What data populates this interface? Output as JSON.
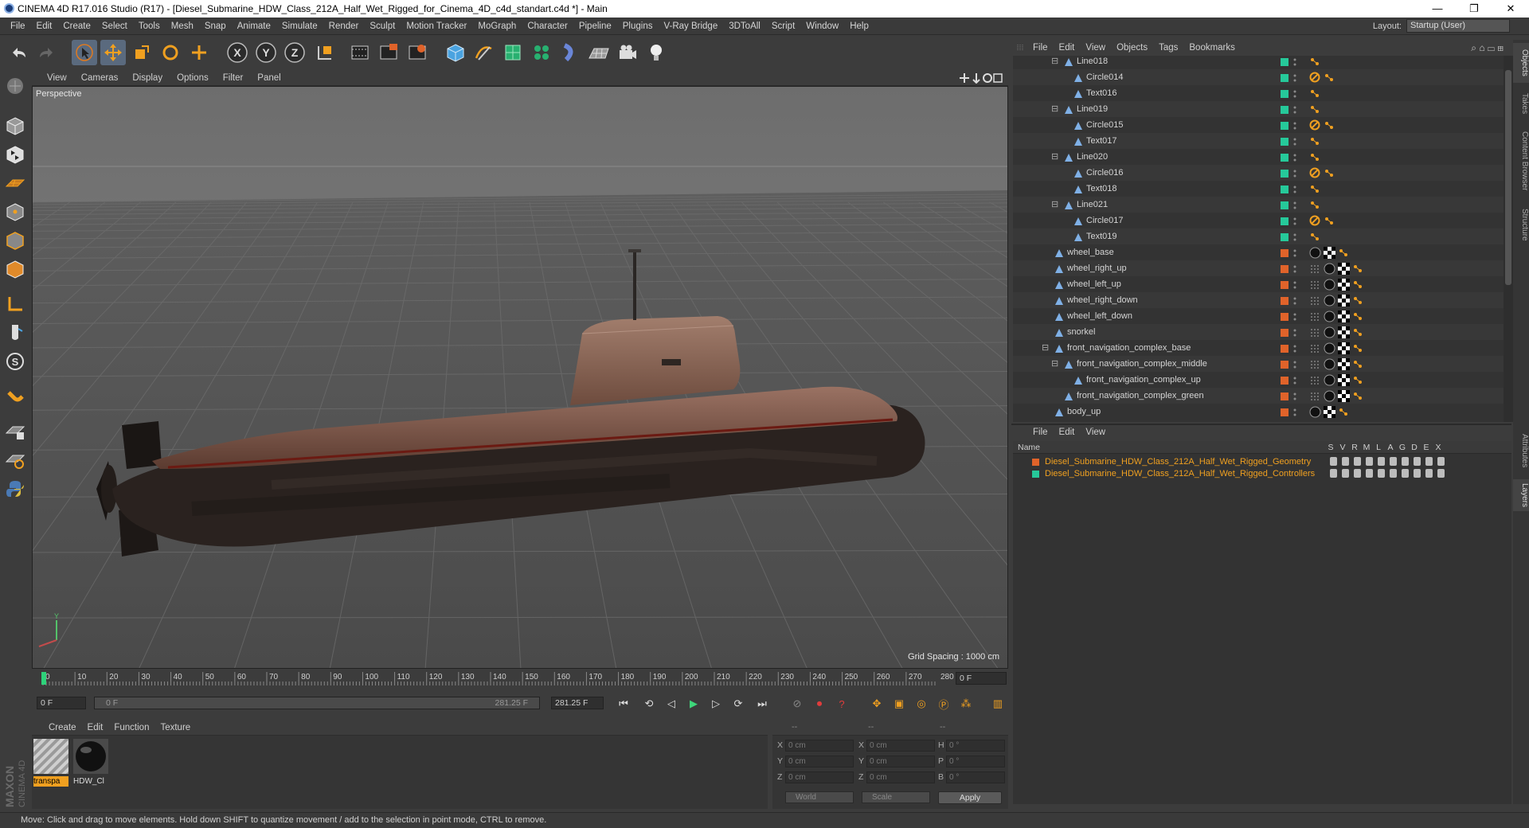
{
  "window": {
    "title": "CINEMA 4D R17.016 Studio (R17) - [Diesel_Submarine_HDW_Class_212A_Half_Wet_Rigged_for_Cinema_4D_c4d_standart.c4d *] - Main",
    "controls": [
      "—",
      "❐",
      "✕"
    ]
  },
  "menubar": {
    "items": [
      "File",
      "Edit",
      "Create",
      "Select",
      "Tools",
      "Mesh",
      "Snap",
      "Animate",
      "Simulate",
      "Render",
      "Sculpt",
      "Motion Tracker",
      "MoGraph",
      "Character",
      "Pipeline",
      "Plugins",
      "V-Ray Bridge",
      "3DToAll",
      "Script",
      "Window",
      "Help"
    ],
    "layout_label": "Layout:",
    "layout_value": "Startup (User)"
  },
  "toolbar": {
    "icons": [
      "undo-icon",
      "redo-icon",
      "live-selection-icon",
      "move-icon",
      "scale-icon",
      "rotate-icon",
      "recent-tool-icon",
      "x-axis-icon",
      "y-axis-icon",
      "z-axis-icon",
      "world-coords-icon",
      "render-view-icon",
      "render-picture-viewer-icon",
      "edit-render-settings-icon",
      "cube-primitive-icon",
      "pen-spline-icon",
      "subdivision-icon",
      "cloner-icon",
      "deformer-icon",
      "floor-icon",
      "camera-icon",
      "light-icon"
    ],
    "axis_letters": [
      "X",
      "Y",
      "Z"
    ]
  },
  "viewport": {
    "menu": [
      "View",
      "Cameras",
      "Display",
      "Options",
      "Filter",
      "Panel"
    ],
    "label": "Perspective",
    "grid_spacing": "Grid Spacing : 1000 cm",
    "axis_y": "Y"
  },
  "timeline": {
    "ticks": [
      "0",
      "10",
      "20",
      "30",
      "40",
      "50",
      "60",
      "70",
      "80",
      "90",
      "100",
      "110",
      "120",
      "130",
      "140",
      "150",
      "160",
      "170",
      "180",
      "190",
      "200",
      "210",
      "220",
      "230",
      "240",
      "250",
      "260",
      "270",
      "280"
    ],
    "end_frame": "0 F",
    "current": "0 F",
    "range_start": "0 F",
    "range_end": "281.25 F",
    "max": "281.25 F",
    "playhead_fraction": 0
  },
  "materials": {
    "menu": [
      "Create",
      "Edit",
      "Function",
      "Texture"
    ],
    "items": [
      {
        "label": "transpa",
        "selected": true
      },
      {
        "label": "HDW_Cl",
        "selected": false
      }
    ]
  },
  "coords": {
    "headers": [
      "--",
      "--",
      "--"
    ],
    "rows": [
      {
        "a": "X",
        "av": "0 cm",
        "b": "X",
        "bv": "0 cm",
        "c": "H",
        "cv": "0 °"
      },
      {
        "a": "Y",
        "av": "0 cm",
        "b": "Y",
        "bv": "0 cm",
        "c": "P",
        "cv": "0 °"
      },
      {
        "a": "Z",
        "av": "0 cm",
        "b": "Z",
        "bv": "0 cm",
        "c": "B",
        "cv": "0 °"
      }
    ],
    "mode1": "World",
    "mode2": "Scale",
    "apply": "Apply"
  },
  "objects": {
    "menu": [
      "File",
      "Edit",
      "View",
      "Objects",
      "Tags",
      "Bookmarks"
    ],
    "rows": [
      {
        "name": "Line018",
        "indent": 2,
        "expander": true,
        "color": "#26c99a",
        "tags": "spline"
      },
      {
        "name": "Circle014",
        "indent": 3,
        "expander": false,
        "color": "#26c99a",
        "tags": "constraint"
      },
      {
        "name": "Text016",
        "indent": 3,
        "expander": false,
        "color": "#26c99a",
        "tags": "spline"
      },
      {
        "name": "Line019",
        "indent": 2,
        "expander": true,
        "color": "#26c99a",
        "tags": "spline"
      },
      {
        "name": "Circle015",
        "indent": 3,
        "expander": false,
        "color": "#26c99a",
        "tags": "constraint"
      },
      {
        "name": "Text017",
        "indent": 3,
        "expander": false,
        "color": "#26c99a",
        "tags": "spline"
      },
      {
        "name": "Line020",
        "indent": 2,
        "expander": true,
        "color": "#26c99a",
        "tags": "spline"
      },
      {
        "name": "Circle016",
        "indent": 3,
        "expander": false,
        "color": "#26c99a",
        "tags": "constraint"
      },
      {
        "name": "Text018",
        "indent": 3,
        "expander": false,
        "color": "#26c99a",
        "tags": "spline"
      },
      {
        "name": "Line021",
        "indent": 2,
        "expander": true,
        "color": "#26c99a",
        "tags": "spline"
      },
      {
        "name": "Circle017",
        "indent": 3,
        "expander": false,
        "color": "#26c99a",
        "tags": "constraint"
      },
      {
        "name": "Text019",
        "indent": 3,
        "expander": false,
        "color": "#26c99a",
        "tags": "spline"
      },
      {
        "name": "wheel_base",
        "indent": 1,
        "expander": false,
        "color": "#e0632a",
        "tags": "mat2"
      },
      {
        "name": "wheel_right_up",
        "indent": 1,
        "expander": false,
        "color": "#e0632a",
        "tags": "mat3"
      },
      {
        "name": "wheel_left_up",
        "indent": 1,
        "expander": false,
        "color": "#e0632a",
        "tags": "mat3"
      },
      {
        "name": "wheel_right_down",
        "indent": 1,
        "expander": false,
        "color": "#e0632a",
        "tags": "mat3"
      },
      {
        "name": "wheel_left_down",
        "indent": 1,
        "expander": false,
        "color": "#e0632a",
        "tags": "mat3"
      },
      {
        "name": "snorkel",
        "indent": 1,
        "expander": false,
        "color": "#e0632a",
        "tags": "mat3"
      },
      {
        "name": "front_navigation_complex_base",
        "indent": 1,
        "expander": true,
        "color": "#e0632a",
        "tags": "mat3"
      },
      {
        "name": "front_navigation_complex_middle",
        "indent": 2,
        "expander": true,
        "color": "#e0632a",
        "tags": "mat3"
      },
      {
        "name": "front_navigation_complex_up",
        "indent": 3,
        "expander": false,
        "color": "#e0632a",
        "tags": "mat3"
      },
      {
        "name": "front_navigation_complex_green",
        "indent": 2,
        "expander": false,
        "color": "#e0632a",
        "tags": "mat3"
      },
      {
        "name": "body_up",
        "indent": 1,
        "expander": false,
        "color": "#e0632a",
        "tags": "mat2"
      }
    ]
  },
  "layers": {
    "menu": [
      "File",
      "Edit",
      "View"
    ],
    "name_col": "Name",
    "flag_cols": [
      "S",
      "V",
      "R",
      "M",
      "L",
      "A",
      "G",
      "D",
      "E",
      "X"
    ],
    "rows": [
      {
        "name": "Diesel_Submarine_HDW_Class_212A_Half_Wet_Rigged_Geometry",
        "color": "#e0632a"
      },
      {
        "name": "Diesel_Submarine_HDW_Class_212A_Half_Wet_Rigged_Controllers",
        "color": "#26c99a"
      }
    ]
  },
  "side_tabs": [
    "Objects",
    "Takes",
    "Content Browser",
    "Structure",
    "Attributes",
    "Layers"
  ],
  "status": "Move: Click and drag to move elements. Hold down SHIFT to quantize movement / add to the selection in point mode, CTRL to remove.",
  "brand": {
    "maxon": "MAXON",
    "c4d": "CINEMA 4D"
  }
}
